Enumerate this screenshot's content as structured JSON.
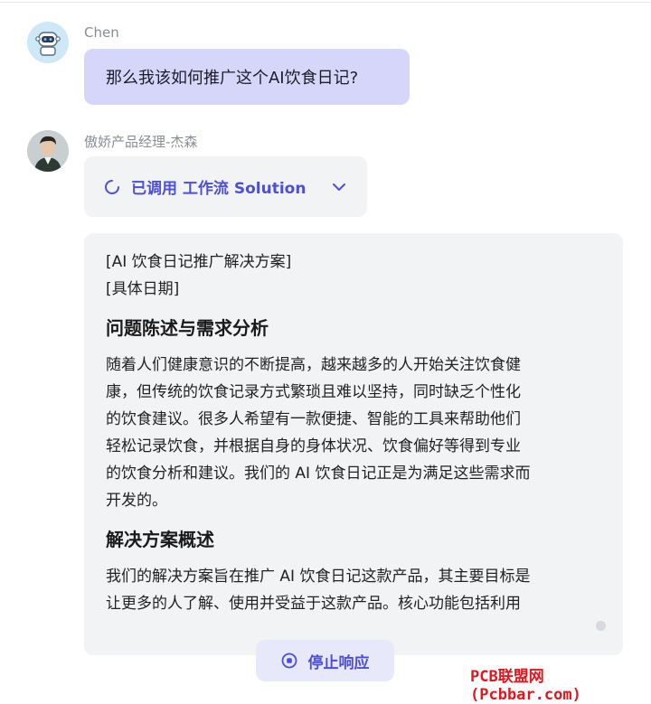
{
  "user": {
    "name": "Chen",
    "message": "那么我该如何推广这个AI饮食日记?"
  },
  "bot": {
    "name": "傲娇产品经理-杰森",
    "tool_call": {
      "label": "已调用 工作流 Solution",
      "icon": "loading-spinner-icon",
      "expand_icon": "chevron-down-icon"
    },
    "answer": {
      "header_lines": [
        "[AI 饮食日记推广解决方案]",
        "[具体日期]"
      ],
      "section1_title": "问题陈述与需求分析",
      "section1_lines": [
        "随着人们健康意识的不断提高，越来越多的人开始关注饮食健",
        "康，但传统的饮食记录方式繁琐且难以坚持，同时缺乏个性化",
        "的饮食建议。很多人希望有一款便捷、智能的工具来帮助他们",
        "轻松记录饮食，并根据自身的身体状况、饮食偏好等得到专业",
        "的饮食分析和建议。我们的 AI 饮食日记正是为满足这些需求而",
        "开发的。"
      ],
      "section2_title": "解决方案概述",
      "section2_lines": [
        "我们的解决方案旨在推广 AI 饮食日记这款产品，其主要目标是",
        "让更多的人了解、使用并受益于这款产品。核心功能包括利用"
      ]
    }
  },
  "stop_button": {
    "label": "停止响应",
    "icon": "stop-circle-icon"
  },
  "watermark": "PCB联盟网 (Pcbbar.com)",
  "colors": {
    "accent": "#4d4fd6",
    "user_bubble": "#d6d6fb",
    "card_bg": "#f2f3f5",
    "watermark": "#e4151d"
  }
}
